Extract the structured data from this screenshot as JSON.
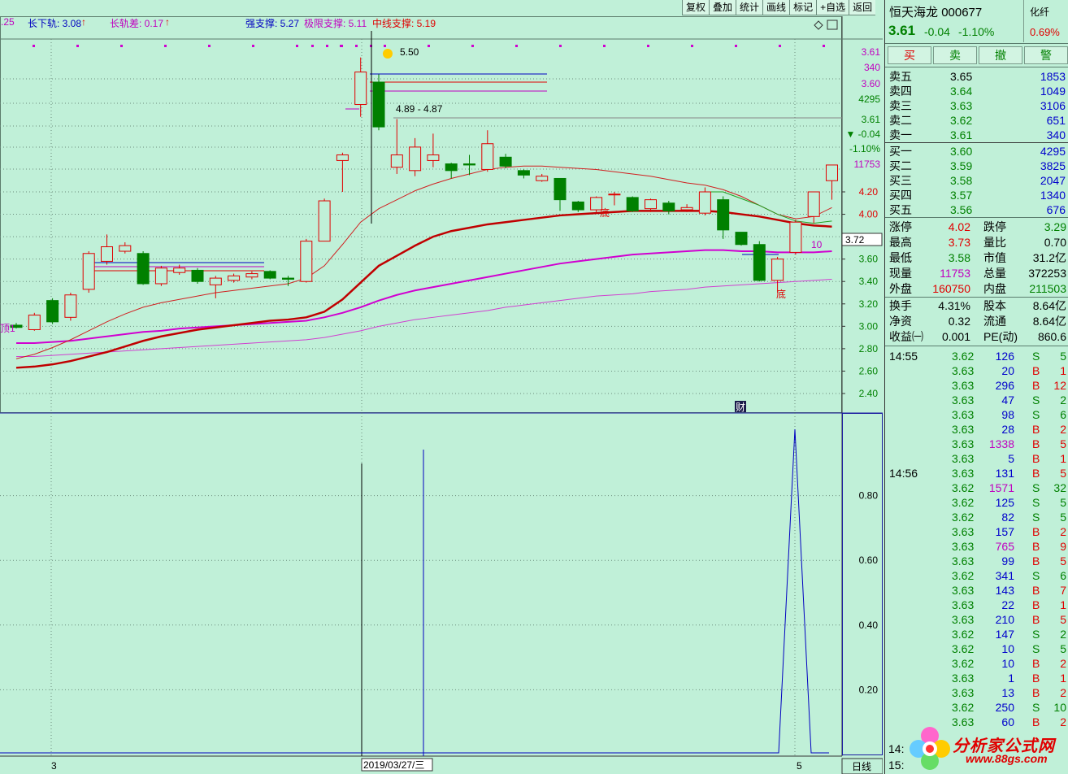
{
  "topbar": {
    "left_fragment": ".25",
    "arrow": "↑",
    "long_lower_track": "长下轨: 3.08",
    "long_track_diff": "长轨差: 0.17",
    "strong_support": "强支撑: 5.27",
    "limit_support": "极限支撑: 5.11",
    "mid_support": "中线支撑: 5.19"
  },
  "toolbar": {
    "buttons": [
      "复权",
      "叠加",
      "统计",
      "画线",
      "标记",
      "+自选",
      "返回"
    ]
  },
  "chart": {
    "annotations": {
      "high_label": "5.50",
      "gap_label": "4.89 - 4.87",
      "di1": "底",
      "di2": "底",
      "cai": "财",
      "ding": "顶1",
      "num10": "10",
      "date_label": "2019/03/27/三",
      "month3": "3",
      "month5": "5",
      "timeframe": "日线"
    },
    "price_axis": [
      "4.20",
      "4.00",
      "3.80",
      "3.60",
      "3.40",
      "3.20",
      "3.00",
      "2.80",
      "2.60",
      "2.40"
    ],
    "price_axis_current": "3.72",
    "sub_axis": [
      "0.80",
      "0.60",
      "0.40",
      "0.20"
    ],
    "right_info": {
      "p1": "3.61",
      "v1": "340",
      "p2": "3.60",
      "v2": "4295",
      "p3": "3.61",
      "chg": "▼ -0.04",
      "pct": "-1.10%",
      "vol": "11753"
    },
    "candles": [
      {
        "o": 3.01,
        "c": 2.99,
        "h": 3.03,
        "l": 2.98
      },
      {
        "o": 2.97,
        "c": 3.1,
        "h": 3.12,
        "l": 2.96
      },
      {
        "o": 3.23,
        "c": 3.04,
        "h": 3.25,
        "l": 3.02
      },
      {
        "o": 3.08,
        "c": 3.28,
        "h": 3.3,
        "l": 3.05
      },
      {
        "o": 3.33,
        "c": 3.65,
        "h": 3.67,
        "l": 3.3
      },
      {
        "o": 3.58,
        "c": 3.71,
        "h": 3.82,
        "l": 3.55
      },
      {
        "o": 3.67,
        "c": 3.72,
        "h": 3.75,
        "l": 3.65
      },
      {
        "o": 3.65,
        "c": 3.38,
        "h": 3.67,
        "l": 3.37
      },
      {
        "o": 3.38,
        "c": 3.52,
        "h": 3.54,
        "l": 3.36
      },
      {
        "o": 3.48,
        "c": 3.52,
        "h": 3.55,
        "l": 3.46
      },
      {
        "o": 3.5,
        "c": 3.4,
        "h": 3.52,
        "l": 3.38
      },
      {
        "o": 3.37,
        "c": 3.43,
        "h": 3.45,
        "l": 3.25
      },
      {
        "o": 3.41,
        "c": 3.45,
        "h": 3.47,
        "l": 3.39
      },
      {
        "o": 3.44,
        "c": 3.47,
        "h": 3.49,
        "l": 3.42
      },
      {
        "o": 3.49,
        "c": 3.43,
        "h": 3.5,
        "l": 3.42
      },
      {
        "o": 3.43,
        "c": 3.42,
        "h": 3.45,
        "l": 3.36
      },
      {
        "o": 3.4,
        "c": 3.76,
        "h": 3.78,
        "l": 3.39
      },
      {
        "o": 3.76,
        "c": 4.12,
        "h": 4.14,
        "l": 3.76
      },
      {
        "o": 4.48,
        "c": 4.53,
        "h": 4.55,
        "l": 4.2
      },
      {
        "o": 4.98,
        "c": 5.27,
        "h": 5.4,
        "l": 4.87
      },
      {
        "o": 5.18,
        "c": 4.78,
        "h": 5.25,
        "l": 4.75
      },
      {
        "o": 4.42,
        "c": 4.53,
        "h": 4.85,
        "l": 4.36
      },
      {
        "o": 4.39,
        "c": 4.6,
        "h": 4.68,
        "l": 4.34
      },
      {
        "o": 4.48,
        "c": 4.53,
        "h": 4.72,
        "l": 4.42
      },
      {
        "o": 4.45,
        "c": 4.39,
        "h": 4.46,
        "l": 4.32
      },
      {
        "o": 4.45,
        "c": 4.44,
        "h": 4.53,
        "l": 4.35
      },
      {
        "o": 4.4,
        "c": 4.63,
        "h": 4.75,
        "l": 4.38
      },
      {
        "o": 4.51,
        "c": 4.43,
        "h": 4.54,
        "l": 4.41
      },
      {
        "o": 4.39,
        "c": 4.35,
        "h": 4.4,
        "l": 4.32
      },
      {
        "o": 4.3,
        "c": 4.34,
        "h": 4.36,
        "l": 4.29
      },
      {
        "o": 4.32,
        "c": 4.13,
        "h": 4.32,
        "l": 4.03
      },
      {
        "o": 4.11,
        "c": 4.04,
        "h": 4.12,
        "l": 4.02
      },
      {
        "o": 4.04,
        "c": 4.15,
        "h": 4.16,
        "l": 4.02
      },
      {
        "o": 4.18,
        "c": 4.18,
        "h": 4.2,
        "l": 4.08
      },
      {
        "o": 4.15,
        "c": 4.03,
        "h": 4.16,
        "l": 4.02
      },
      {
        "o": 4.05,
        "c": 4.13,
        "h": 4.14,
        "l": 4.02
      },
      {
        "o": 4.1,
        "c": 4.03,
        "h": 4.12,
        "l": 4.0
      },
      {
        "o": 4.04,
        "c": 4.06,
        "h": 4.09,
        "l": 4.02
      },
      {
        "o": 4.01,
        "c": 4.2,
        "h": 4.24,
        "l": 3.99
      },
      {
        "o": 4.13,
        "c": 3.86,
        "h": 4.16,
        "l": 3.78
      },
      {
        "o": 3.84,
        "c": 3.73,
        "h": 3.84,
        "l": 3.72
      },
      {
        "o": 3.73,
        "c": 3.41,
        "h": 3.76,
        "l": 3.4
      },
      {
        "o": 3.41,
        "c": 3.6,
        "h": 3.62,
        "l": 3.3
      },
      {
        "o": 3.66,
        "c": 3.93,
        "h": 3.95,
        "l": 3.64
      },
      {
        "o": 3.98,
        "c": 4.2,
        "h": 4.2,
        "l": 3.92
      },
      {
        "o": 4.3,
        "c": 4.44,
        "h": 4.44,
        "l": 4.13
      }
    ],
    "ma_short": [
      2.71,
      2.75,
      2.81,
      2.88,
      2.96,
      3.04,
      3.11,
      3.17,
      3.21,
      3.24,
      3.27,
      3.3,
      3.32,
      3.34,
      3.36,
      3.38,
      3.43,
      3.54,
      3.73,
      3.93,
      4.05,
      4.13,
      4.21,
      4.27,
      4.32,
      4.36,
      4.4,
      4.42,
      4.43,
      4.43,
      4.42,
      4.41,
      4.4,
      4.38,
      4.36,
      4.34,
      4.31,
      4.28,
      4.26,
      4.22,
      4.16,
      4.08,
      4.0,
      3.96,
      3.98,
      4.06
    ],
    "ma_mid": [
      2.63,
      2.64,
      2.66,
      2.69,
      2.73,
      2.77,
      2.82,
      2.87,
      2.91,
      2.94,
      2.97,
      2.99,
      3.01,
      3.03,
      3.05,
      3.06,
      3.08,
      3.13,
      3.24,
      3.39,
      3.54,
      3.63,
      3.72,
      3.8,
      3.85,
      3.88,
      3.91,
      3.93,
      3.95,
      3.97,
      3.99,
      4.0,
      4.01,
      4.02,
      4.03,
      4.03,
      4.03,
      4.03,
      4.03,
      4.02,
      4.0,
      3.98,
      3.95,
      3.92,
      3.9,
      3.89
    ],
    "ma_long": [
      2.85,
      2.85,
      2.86,
      2.87,
      2.89,
      2.91,
      2.93,
      2.95,
      2.96,
      2.98,
      2.99,
      3.0,
      3.01,
      3.02,
      3.03,
      3.04,
      3.05,
      3.08,
      3.12,
      3.17,
      3.23,
      3.28,
      3.32,
      3.35,
      3.38,
      3.41,
      3.44,
      3.47,
      3.5,
      3.53,
      3.56,
      3.58,
      3.6,
      3.62,
      3.64,
      3.65,
      3.66,
      3.67,
      3.68,
      3.68,
      3.67,
      3.67,
      3.66,
      3.66,
      3.66,
      3.67
    ],
    "ma_very_long": [
      2.73,
      2.73,
      2.74,
      2.75,
      2.76,
      2.77,
      2.78,
      2.79,
      2.8,
      2.81,
      2.82,
      2.83,
      2.84,
      2.85,
      2.86,
      2.87,
      2.88,
      2.9,
      2.93,
      2.96,
      3.0,
      3.03,
      3.06,
      3.08,
      3.1,
      3.12,
      3.14,
      3.17,
      3.19,
      3.21,
      3.23,
      3.25,
      3.27,
      3.28,
      3.29,
      3.31,
      3.32,
      3.33,
      3.35,
      3.36,
      3.37,
      3.38,
      3.39,
      3.4,
      3.41,
      3.42
    ],
    "green_line": [
      null,
      null,
      null,
      null,
      null,
      null,
      null,
      null,
      null,
      null,
      null,
      null,
      null,
      null,
      null,
      null,
      null,
      null,
      null,
      null,
      null,
      null,
      null,
      null,
      null,
      null,
      null,
      null,
      null,
      null,
      null,
      null,
      null,
      null,
      null,
      null,
      null,
      null,
      4.2,
      4.2,
      4.14,
      4.08,
      4.0,
      3.94,
      3.92,
      3.94
    ],
    "sub_series": [
      0,
      0,
      0,
      0,
      0,
      0,
      0,
      0,
      0,
      0,
      0,
      0,
      0,
      0,
      0,
      0,
      0,
      0,
      0,
      0,
      0,
      0,
      0,
      0,
      0,
      0,
      0,
      0,
      0,
      0,
      0,
      0,
      0,
      0,
      0,
      0,
      0,
      0,
      0,
      0,
      0,
      0,
      0,
      1.0,
      0,
      0
    ]
  },
  "right_panel": {
    "name": "恒天海龙",
    "code": "000677",
    "industry": "化纤",
    "industry_pct": "0.69%",
    "price": "3.61",
    "change": "-0.04",
    "change_pct": "-1.10%",
    "buttons": [
      "买",
      "卖",
      "撤",
      "警"
    ],
    "asks": [
      {
        "label": "卖五",
        "price": "3.65",
        "vol": "1853"
      },
      {
        "label": "卖四",
        "price": "3.64",
        "vol": "1049"
      },
      {
        "label": "卖三",
        "price": "3.63",
        "vol": "3106"
      },
      {
        "label": "卖二",
        "price": "3.62",
        "vol": "651"
      },
      {
        "label": "卖一",
        "price": "3.61",
        "vol": "340"
      }
    ],
    "bids": [
      {
        "label": "买一",
        "price": "3.60",
        "vol": "4295"
      },
      {
        "label": "买二",
        "price": "3.59",
        "vol": "3825"
      },
      {
        "label": "买三",
        "price": "3.58",
        "vol": "2047"
      },
      {
        "label": "买四",
        "price": "3.57",
        "vol": "1340"
      },
      {
        "label": "买五",
        "price": "3.56",
        "vol": "676"
      }
    ],
    "stats1": [
      {
        "l1": "涨停",
        "v1": "4.02",
        "l2": "跌停",
        "v2": "3.29"
      },
      {
        "l1": "最高",
        "v1": "3.73",
        "l2": "量比",
        "v2": "0.70"
      },
      {
        "l1": "最低",
        "v1": "3.58",
        "l2": "市值",
        "v2": "31.2亿"
      },
      {
        "l1": "现量",
        "v1": "11753",
        "l2": "总量",
        "v2": "372253"
      },
      {
        "l1": "外盘",
        "v1": "160750",
        "l2": "内盘",
        "v2": "211503"
      }
    ],
    "stats2": [
      {
        "l1": "换手",
        "v1": "4.31%",
        "l2": "股本",
        "v2": "8.64亿"
      },
      {
        "l1": "净资",
        "v1": "0.32",
        "l2": "流通",
        "v2": "8.64亿"
      },
      {
        "l1": "收益㈠",
        "v1": "0.001",
        "l2": "PE(动)",
        "v2": "860.6"
      }
    ],
    "ticks": [
      {
        "t": "14:55",
        "p": "3.62",
        "v": "126",
        "s": "S",
        "n": "5"
      },
      {
        "t": "",
        "p": "3.63",
        "v": "20",
        "s": "B",
        "n": "1"
      },
      {
        "t": "",
        "p": "3.63",
        "v": "296",
        "s": "B",
        "n": "12"
      },
      {
        "t": "",
        "p": "3.63",
        "v": "47",
        "s": "S",
        "n": "2"
      },
      {
        "t": "",
        "p": "3.63",
        "v": "98",
        "s": "S",
        "n": "6"
      },
      {
        "t": "",
        "p": "3.63",
        "v": "28",
        "s": "B",
        "n": "2"
      },
      {
        "t": "",
        "p": "3.63",
        "v": "1338",
        "s": "B",
        "n": "5"
      },
      {
        "t": "",
        "p": "3.63",
        "v": "5",
        "s": "B",
        "n": "1"
      },
      {
        "t": "14:56",
        "p": "3.63",
        "v": "131",
        "s": "B",
        "n": "5"
      },
      {
        "t": "",
        "p": "3.62",
        "v": "1571",
        "s": "S",
        "n": "32"
      },
      {
        "t": "",
        "p": "3.62",
        "v": "125",
        "s": "S",
        "n": "5"
      },
      {
        "t": "",
        "p": "3.62",
        "v": "82",
        "s": "S",
        "n": "5"
      },
      {
        "t": "",
        "p": "3.63",
        "v": "157",
        "s": "B",
        "n": "2"
      },
      {
        "t": "",
        "p": "3.63",
        "v": "765",
        "s": "B",
        "n": "9"
      },
      {
        "t": "",
        "p": "3.63",
        "v": "99",
        "s": "B",
        "n": "5"
      },
      {
        "t": "",
        "p": "3.62",
        "v": "341",
        "s": "S",
        "n": "6"
      },
      {
        "t": "",
        "p": "3.63",
        "v": "143",
        "s": "B",
        "n": "7"
      },
      {
        "t": "",
        "p": "3.63",
        "v": "22",
        "s": "B",
        "n": "1"
      },
      {
        "t": "",
        "p": "3.63",
        "v": "210",
        "s": "B",
        "n": "5"
      },
      {
        "t": "",
        "p": "3.62",
        "v": "147",
        "s": "S",
        "n": "2"
      },
      {
        "t": "",
        "p": "3.62",
        "v": "10",
        "s": "S",
        "n": "5"
      },
      {
        "t": "",
        "p": "3.62",
        "v": "10",
        "s": "B",
        "n": "2"
      },
      {
        "t": "",
        "p": "3.63",
        "v": "1",
        "s": "B",
        "n": "1"
      },
      {
        "t": "",
        "p": "3.63",
        "v": "13",
        "s": "B",
        "n": "2"
      },
      {
        "t": "",
        "p": "3.62",
        "v": "250",
        "s": "S",
        "n": "10"
      },
      {
        "t": "",
        "p": "3.63",
        "v": "60",
        "s": "B",
        "n": "2"
      }
    ],
    "tick_time_bottom1": "14:",
    "tick_time_bottom2": "15:"
  },
  "watermark": {
    "text": "分析家公式网",
    "url": "www.88gs.com"
  },
  "colors": {
    "up": "#e00000",
    "down": "#008000",
    "ma_short": "#d02020",
    "ma_mid": "#c00000",
    "ma_long": "#d000d0",
    "ma_very_long": "#d040d0",
    "green_line": "#20a020",
    "sub_line": "#0000c0"
  }
}
